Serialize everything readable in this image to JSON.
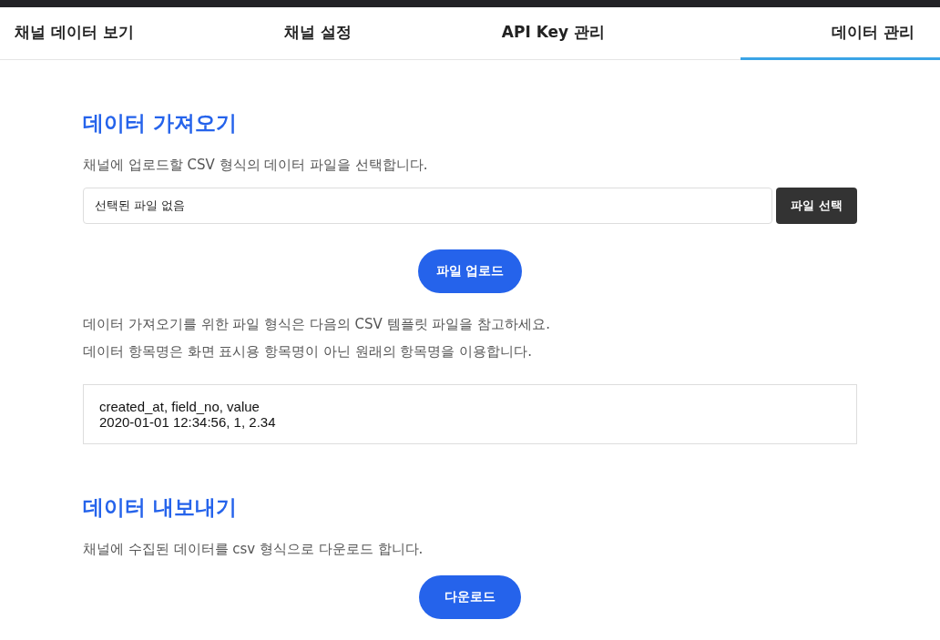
{
  "tabs": [
    {
      "label": "채널 데이터 보기",
      "selected": false
    },
    {
      "label": "채널 설정",
      "selected": false
    },
    {
      "label": "API Key 관리",
      "selected": false
    },
    {
      "label": "데이터 관리",
      "selected": true
    }
  ],
  "import": {
    "title": "데이터 가져오기",
    "description": "채널에 업로드할 CSV 형식의 데이터 파일을 선택합니다.",
    "file_field": {
      "value": "선택된 파일 없음"
    },
    "choose_button": "파일 선택",
    "upload_button": "파일 업로드",
    "notes": [
      "데이터 가져오기를 위한 파일 형식은 다음의 CSV 템플릿 파일을 참고하세요.",
      "데이터 항목명은 화면 표시용 항목명이 아닌 원래의 항목명을 이용합니다."
    ],
    "template_lines": [
      "created_at, field_no, value",
      "2020-01-01 12:34:56, 1, 2.34"
    ]
  },
  "export": {
    "title": "데이터 내보내기",
    "description": "채널에 수집된 데이터를 csv 형식으로 다운로드 합니다.",
    "download_button": "다운로드"
  }
}
